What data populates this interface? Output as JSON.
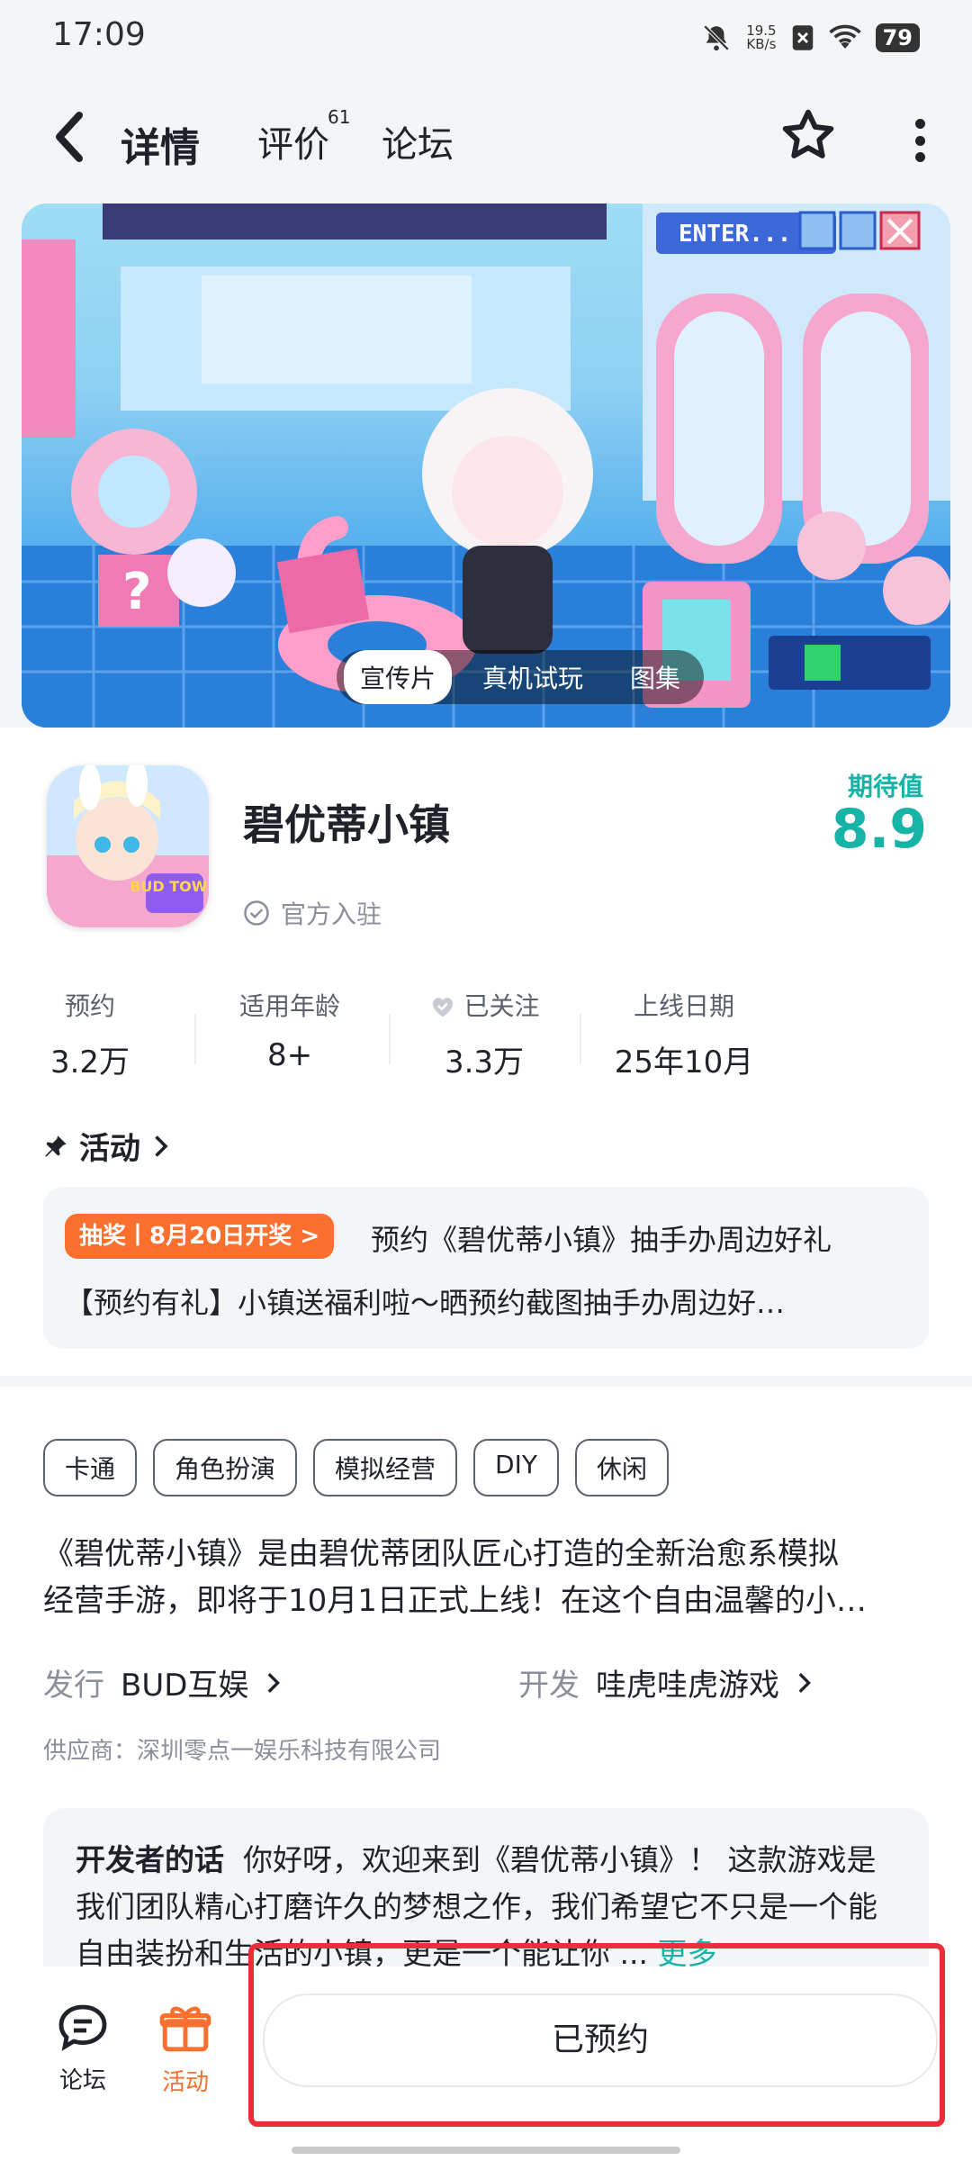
{
  "status_bar": {
    "time": "17:09",
    "net_speed_value": "19.5",
    "net_speed_unit": "KB/s",
    "battery": "79"
  },
  "nav": {
    "tabs": [
      {
        "label": "详情",
        "active": true
      },
      {
        "label": "评价",
        "badge": "61"
      },
      {
        "label": "论坛"
      }
    ],
    "favorite_icon": "star-icon",
    "more_icon": "more-vertical-icon"
  },
  "banner": {
    "ui_text": "ENTER...",
    "media_tabs": [
      {
        "label": "宣传片",
        "active": true
      },
      {
        "label": "真机试玩"
      },
      {
        "label": "图集"
      }
    ]
  },
  "app": {
    "name": "碧优蒂小镇",
    "icon_text": "BUD TOWN",
    "official_label": "官方入驻",
    "rating_label": "期待值",
    "rating_value": "8.9"
  },
  "stats": [
    {
      "label": "预约",
      "value": "3.2万"
    },
    {
      "label": "适用年龄",
      "value": "8+"
    },
    {
      "label": "已关注",
      "value": "3.3万",
      "icon": "heart-check-icon"
    },
    {
      "label": "上线日期",
      "value": "25年10月"
    }
  ],
  "activity": {
    "header": "活动",
    "badge": "抽奖丨8月20日开奖 >",
    "title": "预约《碧优蒂小镇》抽手办周边好礼",
    "desc": "【预约有礼】小镇送福利啦～晒预约截图抽手办周边好…"
  },
  "tags": [
    "卡通",
    "角色扮演",
    "模拟经营",
    "DIY",
    "休闲"
  ],
  "description": {
    "line1": "《碧优蒂小镇》是由碧优蒂团队匠心打造的全新治愈系模拟",
    "line2": "经营手游，即将于10月1日正式上线！在这个自由温馨的小…"
  },
  "publisher": {
    "key": "发行",
    "value": "BUD互娱"
  },
  "developer": {
    "key": "开发",
    "value": "哇虎哇虎游戏"
  },
  "supplier": "供应商：深圳零点一娱乐科技有限公司",
  "dev_note": {
    "label": "开发者的话",
    "text": "你好呀，欢迎来到《碧优蒂小镇》！ 这款游戏是我们团队精心打磨许久的梦想之作，我们希望它不只是一个能自由装扮和生活的小镇，更是一个能让你 ...",
    "more": "更多"
  },
  "bottom_bar": {
    "forum": {
      "label": "论坛",
      "icon": "forum-chat-icon"
    },
    "activity": {
      "label": "活动",
      "icon": "gift-icon"
    },
    "reserve_button": "已预约"
  },
  "colors": {
    "accent": "#17b3a7",
    "tab_underline": "#19d3c4",
    "badge_orange": "#fb6f2f",
    "highlight_red": "#ea2f3a"
  }
}
